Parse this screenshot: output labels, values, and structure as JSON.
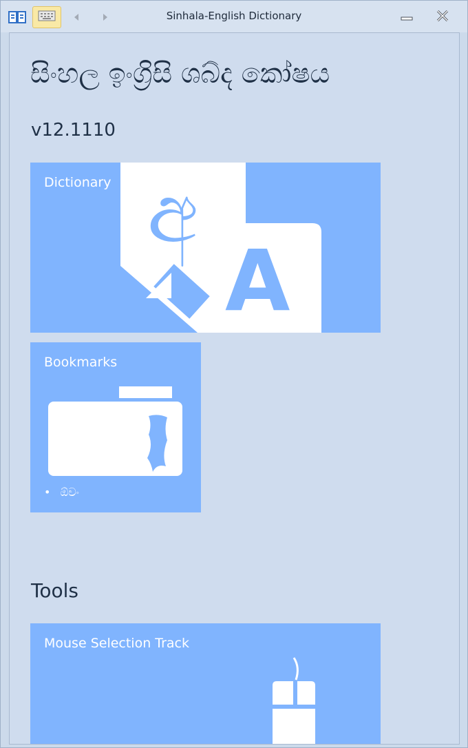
{
  "window": {
    "title": "Sinhala-English Dictionary"
  },
  "header": {
    "app_title": "සිංහල ඉංග්‍රිසි ශබ්ද කෝෂය",
    "version": "v12.1110"
  },
  "tiles": {
    "dictionary": {
      "label": "Dictionary",
      "glyph_sinhala": "අ",
      "glyph_latin": "A"
    },
    "bookmarks": {
      "label": "Bookmarks",
      "items": [
        "ඕවං"
      ]
    }
  },
  "tools": {
    "section_title": "Tools",
    "mouse_tile_label": "Mouse Selection Track"
  },
  "colors": {
    "tile": "#80b4fe",
    "accent": "#f9e9a6",
    "text": "#1f3046"
  }
}
